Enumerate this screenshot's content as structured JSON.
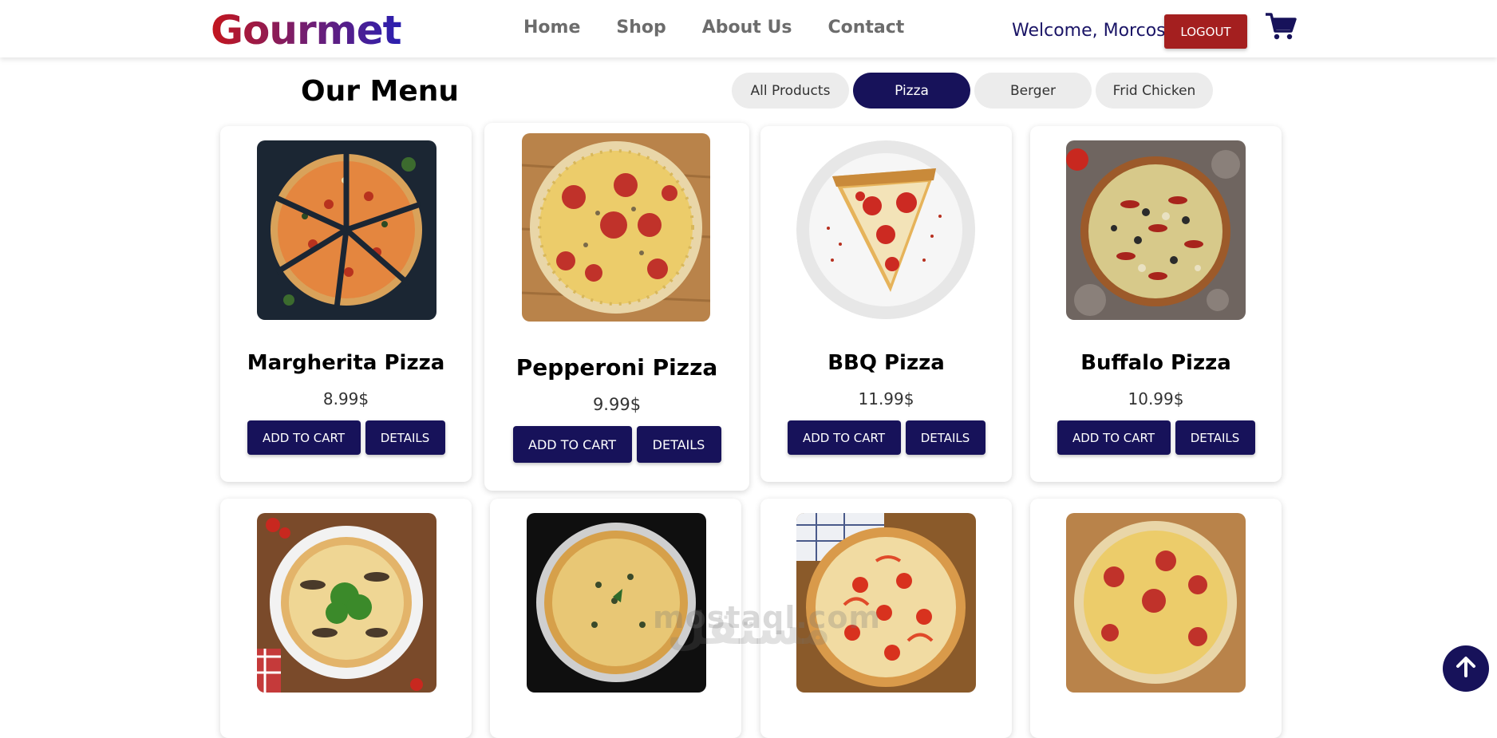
{
  "brand": {
    "name": "Gourmet",
    "gradient": [
      "#c4151c",
      "#2a1fb0"
    ]
  },
  "nav": {
    "links": [
      {
        "label": "Home"
      },
      {
        "label": "Shop"
      },
      {
        "label": "About Us"
      },
      {
        "label": "Contact"
      }
    ],
    "welcome": "Welcome, Morcos |",
    "logout_label": "LOGOUT",
    "cart_icon": "shopping-cart-icon"
  },
  "menu": {
    "title": "Our Menu",
    "filters": [
      {
        "label": "All Products",
        "active": false
      },
      {
        "label": "Pizza",
        "active": true
      },
      {
        "label": "Berger",
        "active": false
      },
      {
        "label": "Frid Chicken",
        "active": false
      }
    ]
  },
  "products": [
    {
      "name": "Margherita Pizza",
      "price": "8.99$",
      "add_label": "ADD TO CART",
      "details_label": "DETAILS"
    },
    {
      "name": "Pepperoni Pizza",
      "price": "9.99$",
      "add_label": "ADD TO CART",
      "details_label": "DETAILS"
    },
    {
      "name": "BBQ Pizza",
      "price": "11.99$",
      "add_label": "ADD TO CART",
      "details_label": "DETAILS"
    },
    {
      "name": "Buffalo Pizza",
      "price": "10.99$",
      "add_label": "ADD TO CART",
      "details_label": "DETAILS"
    }
  ],
  "watermark": {
    "logo": "مستقل",
    "text": "mostaql.com"
  },
  "scroll_top_icon": "arrow-up-icon",
  "colors": {
    "primary": "#17125a",
    "logout": "#a41f1f",
    "filter_bg": "#ececec"
  }
}
